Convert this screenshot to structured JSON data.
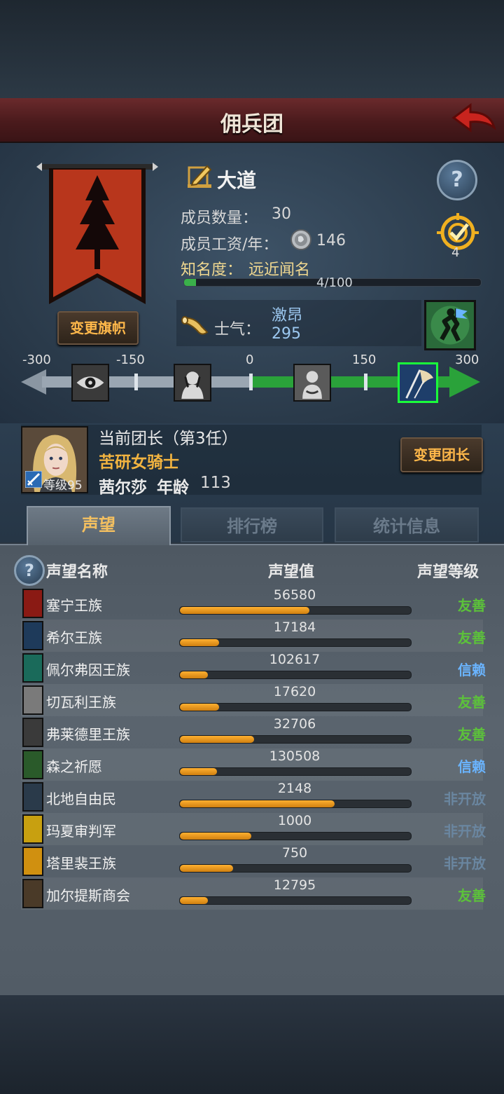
{
  "header": {
    "title": "佣兵团"
  },
  "guild": {
    "name": "大道",
    "member_count_label": "成员数量：",
    "member_count": "30",
    "salary_label": "成员工资/年：",
    "salary": "146",
    "fame_label": "知名度：",
    "fame_title": "远近闻名",
    "fame_progress_text": "4/100",
    "fame_progress": 0.04,
    "change_flag_label": "变更旗帜",
    "badge_count": "4",
    "colors": {
      "banner": "#b8361c",
      "fame_bar": "#3ab04a"
    }
  },
  "morale": {
    "label": "士气：",
    "state": "激昂",
    "value": "295",
    "scale_ticks": [
      "-300",
      "-150",
      "0",
      "150",
      "300"
    ],
    "scale_min": -300,
    "scale_max": 300,
    "current": 295,
    "stage_icons": [
      "eye-icon",
      "weeping-icon",
      "calm-icon",
      "victory-flag-icon"
    ]
  },
  "leader": {
    "title": "当前团长（第3任）",
    "class": "苦研女骑士",
    "name": "茜尔莎",
    "age_label": "年龄",
    "age": "113",
    "level_text": "等级95",
    "change_label": "变更团长"
  },
  "tabs": [
    {
      "label": "声望",
      "active": true
    },
    {
      "label": "排行榜",
      "active": false
    },
    {
      "label": "统计信息",
      "active": false
    }
  ],
  "reputation": {
    "col_name": "声望名称",
    "col_value": "声望值",
    "col_level": "声望等级",
    "rows": [
      {
        "name": "塞宁王族",
        "value": "56580",
        "progress": 0.56,
        "level": "友善",
        "level_color": "#5cc23a",
        "icon_color": "#8a1a14"
      },
      {
        "name": "希尔王族",
        "value": "17184",
        "progress": 0.17,
        "level": "友善",
        "level_color": "#5cc23a",
        "icon_color": "#1e3a5a"
      },
      {
        "name": "佩尔弗因王族",
        "value": "102617",
        "progress": 0.12,
        "level": "信赖",
        "level_color": "#6ab4ff",
        "icon_color": "#1a6a5a"
      },
      {
        "name": "切瓦利王族",
        "value": "17620",
        "progress": 0.17,
        "level": "友善",
        "level_color": "#5cc23a",
        "icon_color": "#7a7a7a"
      },
      {
        "name": "弗莱德里王族",
        "value": "32706",
        "progress": 0.32,
        "level": "友善",
        "level_color": "#5cc23a",
        "icon_color": "#3a3a3a"
      },
      {
        "name": "森之祈愿",
        "value": "130508",
        "progress": 0.16,
        "level": "信赖",
        "level_color": "#6ab4ff",
        "icon_color": "#2a5a2a"
      },
      {
        "name": "北地自由民",
        "value": "2148",
        "progress": 0.67,
        "level": "非开放",
        "level_color": "#6a86a0",
        "icon_color": "#2a3a4a"
      },
      {
        "name": "玛夏审判军",
        "value": "1000",
        "progress": 0.31,
        "level": "非开放",
        "level_color": "#6a86a0",
        "icon_color": "#c8a010"
      },
      {
        "name": "塔里裴王族",
        "value": "750",
        "progress": 0.23,
        "level": "非开放",
        "level_color": "#6a86a0",
        "icon_color": "#d09010"
      },
      {
        "name": "加尔提斯商会",
        "value": "12795",
        "progress": 0.12,
        "level": "友善",
        "level_color": "#5cc23a",
        "icon_color": "#4a3a28"
      }
    ]
  }
}
